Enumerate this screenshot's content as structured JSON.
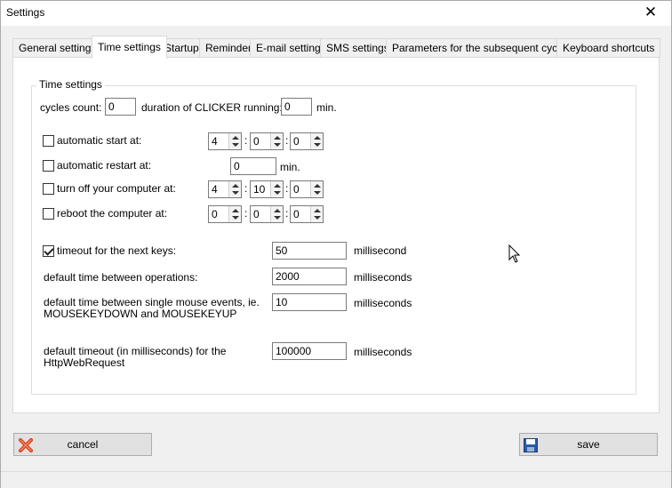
{
  "window": {
    "title": "Settings",
    "close_glyph": "✕"
  },
  "tabs": [
    {
      "label": "General settings",
      "active": false
    },
    {
      "label": "Time settings",
      "active": true
    },
    {
      "label": "Startup",
      "active": false
    },
    {
      "label": "Reminder",
      "active": false
    },
    {
      "label": "E-mail settings",
      "active": false
    },
    {
      "label": "SMS settings",
      "active": false
    },
    {
      "label": "Parameters for the subsequent cycles",
      "active": false
    },
    {
      "label": "Keyboard shortcuts",
      "active": false
    }
  ],
  "group": {
    "legend": "Time settings"
  },
  "cycles": {
    "label": "cycles count:",
    "value": "0",
    "duration_label": "duration of CLICKER running:",
    "duration_value": "0",
    "duration_unit": "min."
  },
  "schedule": {
    "auto_start": {
      "label": "automatic start at:",
      "checked": false,
      "h": "4",
      "m": "0",
      "s": "0"
    },
    "auto_restart": {
      "label": "automatic restart at:",
      "checked": false,
      "value": "0",
      "unit": "min."
    },
    "turn_off": {
      "label": "turn off your computer at:",
      "checked": false,
      "h": "4",
      "m": "10",
      "s": "0"
    },
    "reboot": {
      "label": "reboot the computer at:",
      "checked": false,
      "h": "0",
      "m": "0",
      "s": "0"
    },
    "colon": ":"
  },
  "timing": {
    "timeout_keys": {
      "label": "timeout for the next keys:",
      "checked": true,
      "value": "50",
      "unit": "millisecond"
    },
    "between_ops": {
      "label": "default time between operations:",
      "value": "2000",
      "unit": "milliseconds"
    },
    "mouse_events": {
      "label_line1": "default time between single mouse events, ie.",
      "label_line2": "MOUSEKEYDOWN and MOUSEKEYUP",
      "value": "10",
      "unit": "milliseconds"
    },
    "http_timeout": {
      "label_line1": "default timeout (in milliseconds) for the",
      "label_line2": "HttpWebRequest",
      "value": "100000",
      "unit": "milliseconds"
    }
  },
  "buttons": {
    "cancel": {
      "label": "cancel",
      "icon": "red-x-icon"
    },
    "save": {
      "label": "save",
      "icon": "floppy-disk-icon"
    }
  }
}
